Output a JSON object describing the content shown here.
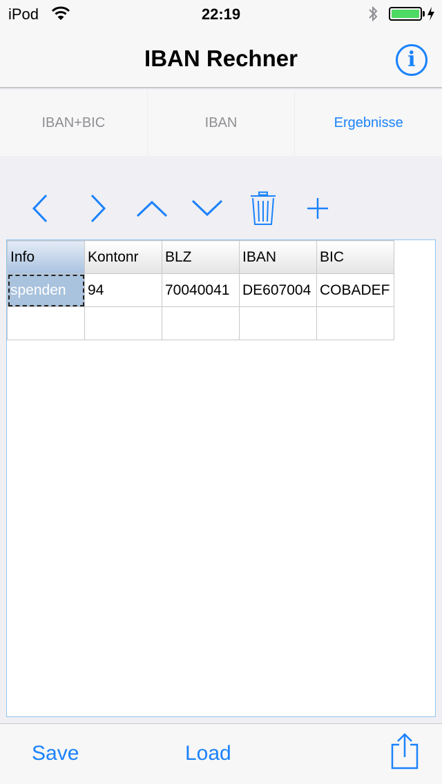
{
  "status_bar": {
    "carrier": "iPod",
    "time": "22:19"
  },
  "nav": {
    "title": "IBAN Rechner",
    "info_symbol": "i"
  },
  "tabs": [
    {
      "label": "IBAN+BIC",
      "active": false
    },
    {
      "label": "IBAN",
      "active": false
    },
    {
      "label": "Ergebnisse",
      "active": true
    }
  ],
  "toolbar": {
    "icons": [
      "chevron-left-icon",
      "chevron-right-icon",
      "chevron-up-icon",
      "chevron-down-icon",
      "trash-icon",
      "plus-icon"
    ]
  },
  "grid": {
    "headers": [
      "Info",
      "Kontonr",
      "BLZ",
      "IBAN",
      "BIC"
    ],
    "rows": [
      [
        "spenden",
        "94",
        "70040041",
        "DE607004",
        "COBADEF"
      ],
      [
        "",
        "",
        "",
        "",
        ""
      ]
    ],
    "selected_cell": "spenden"
  },
  "bottom_bar": {
    "save_label": "Save",
    "load_label": "Load",
    "share_icon": "share-icon"
  },
  "colors": {
    "accent": "#1a82fb",
    "battery": "#4cd964",
    "selection": "#a9c2dd"
  }
}
